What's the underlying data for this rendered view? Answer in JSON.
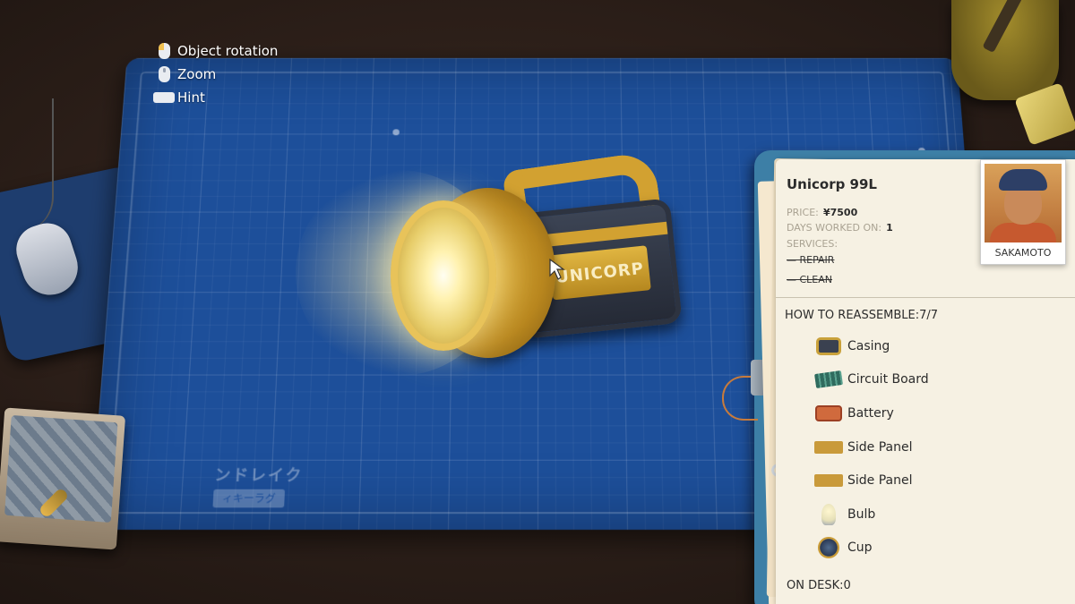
{
  "controls": {
    "rotation": "Object rotation",
    "zoom": "Zoom",
    "hint": "Hint"
  },
  "mat": {
    "brand_line1": "ンドレイク",
    "brand_line2": "ィキーラグ"
  },
  "flashlight": {
    "logo": "UNICORP"
  },
  "job": {
    "title": "Unicorp 99L",
    "price_label": "PRICE:",
    "price_value": "¥7500",
    "days_label": "DAYS WORKED ON:",
    "days_value": "1",
    "services_label": "SERVICES:",
    "services": [
      "— REPAIR",
      "— CLEAN"
    ],
    "customer": "SAKAMOTO"
  },
  "reassemble": {
    "title": "HOW TO REASSEMBLE:7/7",
    "parts": [
      {
        "label": "Casing",
        "icon": "casing-icon"
      },
      {
        "label": "Circuit Board",
        "icon": "circuit-board-icon"
      },
      {
        "label": "Battery",
        "icon": "battery-icon"
      },
      {
        "label": "Side Panel",
        "icon": "side-panel-icon"
      },
      {
        "label": "Side Panel",
        "icon": "side-panel-icon"
      },
      {
        "label": "Bulb",
        "icon": "bulb-icon"
      },
      {
        "label": "Cup",
        "icon": "cup-icon"
      }
    ]
  },
  "on_desk": "ON DESK:0",
  "colors": {
    "blueprint": "#1d4f9a",
    "clipboard": "#3d7fa6",
    "paper": "#f6f1e3",
    "flashlight_yellow": "#d2a131"
  }
}
